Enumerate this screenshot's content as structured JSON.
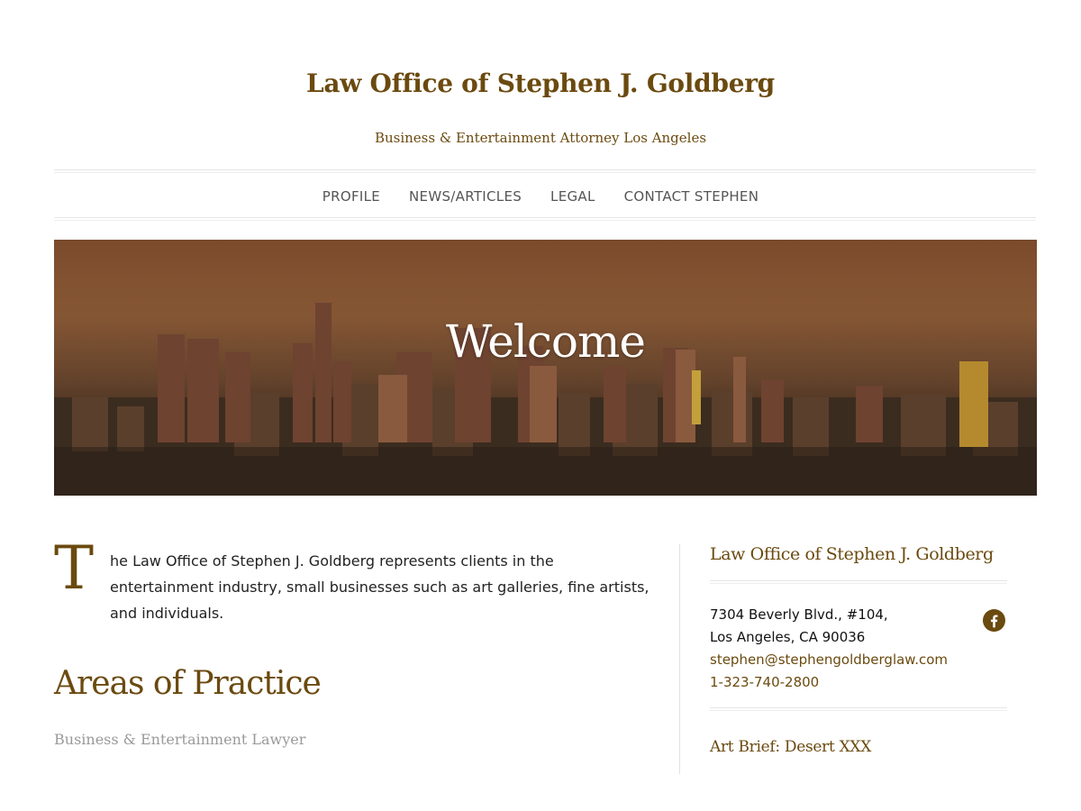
{
  "header": {
    "site_title": "Law Office of Stephen J. Goldberg",
    "tagline": "Business & Entertainment Attorney Los Angeles"
  },
  "nav": {
    "items": [
      {
        "label": "PROFILE"
      },
      {
        "label": "NEWS/ARTICLES"
      },
      {
        "label": "LEGAL"
      },
      {
        "label": "CONTACT STEPHEN"
      }
    ]
  },
  "hero": {
    "title": "Welcome"
  },
  "intro": {
    "drop_cap": "T",
    "text": "he Law Office of Stephen J. Goldberg represents clients in the entertainment industry, small businesses such as art galleries, fine artists, and individuals."
  },
  "practice": {
    "heading": "Areas of Practice",
    "subheading": "Business & Entertainment Lawyer"
  },
  "sidebar": {
    "title": "Law Office of Stephen J. Goldberg",
    "address_line1": "7304 Beverly Blvd., #104,",
    "address_line2": "Los Angeles, CA 90036",
    "email": "stephen@stephengoldberglaw.com",
    "phone": "1-323-740-2800",
    "social_icon": "facebook-icon",
    "post_link": "Art Brief: Desert XXX"
  },
  "colors": {
    "brand": "#6b4a0f",
    "nav_text": "#555555",
    "muted": "#9a9a9a"
  }
}
